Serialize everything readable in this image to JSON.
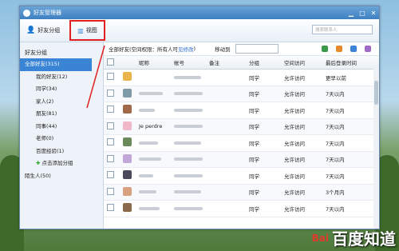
{
  "window": {
    "title": "好友管理器"
  },
  "toolbar": {
    "group_label": "好友分组",
    "view_label": "视图",
    "search_placeholder": "搜索联系人"
  },
  "sidebar": {
    "header": "好友分组",
    "items": [
      {
        "label": "全部好友(315)",
        "active": true,
        "indent": false
      },
      {
        "label": "我的好友(12)",
        "active": false,
        "indent": true
      },
      {
        "label": "同学(34)",
        "active": false,
        "indent": true
      },
      {
        "label": "家人(2)",
        "active": false,
        "indent": true
      },
      {
        "label": "朋友(81)",
        "active": false,
        "indent": true
      },
      {
        "label": "同事(44)",
        "active": false,
        "indent": true
      },
      {
        "label": "老师(0)",
        "active": false,
        "indent": true
      },
      {
        "label": "百度经验(1)",
        "active": false,
        "indent": true
      }
    ],
    "add_group": "点击添加分组",
    "strangers": "陌生人(50)"
  },
  "main": {
    "permission_prefix": "全部好友(空间权限：所有人可",
    "permission_link": "见修改",
    "permission_suffix": ")",
    "move_to": "移动到",
    "columns": [
      "昵称",
      "帐号",
      "备注",
      "分组",
      "空间访问",
      "最后登录时间"
    ]
  },
  "rows": [
    {
      "nick": "",
      "acct": "",
      "note": "",
      "group": "同学",
      "perm": "允许访问",
      "last": "更早以前",
      "avatar": "#e9b44c"
    },
    {
      "nick": "",
      "acct": "",
      "note": "",
      "group": "同学",
      "perm": "允许访问",
      "last": "7天以内",
      "avatar": "#7f9aa8"
    },
    {
      "nick": "",
      "acct": "",
      "note": "",
      "group": "同学",
      "perm": "允许访问",
      "last": "7天以内",
      "avatar": "#a06a4a"
    },
    {
      "nick": "Je perdre",
      "acct": "",
      "note": "",
      "group": "同学",
      "perm": "允许访问",
      "last": "7天以内",
      "avatar": "#f0b8c8"
    },
    {
      "nick": "",
      "acct": "",
      "note": "",
      "group": "同学",
      "perm": "允许访问",
      "last": "7天以内",
      "avatar": "#6a8a5a"
    },
    {
      "nick": "",
      "acct": "",
      "note": "",
      "group": "同学",
      "perm": "允许访问",
      "last": "7天以内",
      "avatar": "#c2a8d8"
    },
    {
      "nick": "",
      "acct": "",
      "note": "",
      "group": "同学",
      "perm": "允许访问",
      "last": "7天以内",
      "avatar": "#4a4a5a"
    },
    {
      "nick": "",
      "acct": "",
      "note": "",
      "group": "同学",
      "perm": "允许访问",
      "last": "3个月内",
      "avatar": "#d9a080"
    },
    {
      "nick": "",
      "acct": "",
      "note": "",
      "group": "同学",
      "perm": "允许访问",
      "last": "7天以内",
      "avatar": "#8a6a4a"
    }
  ],
  "watermark": {
    "en": "Bai",
    "cn": "百度知道"
  },
  "colors": {
    "accent": "#3a84d6",
    "annotation": "#e02020"
  }
}
